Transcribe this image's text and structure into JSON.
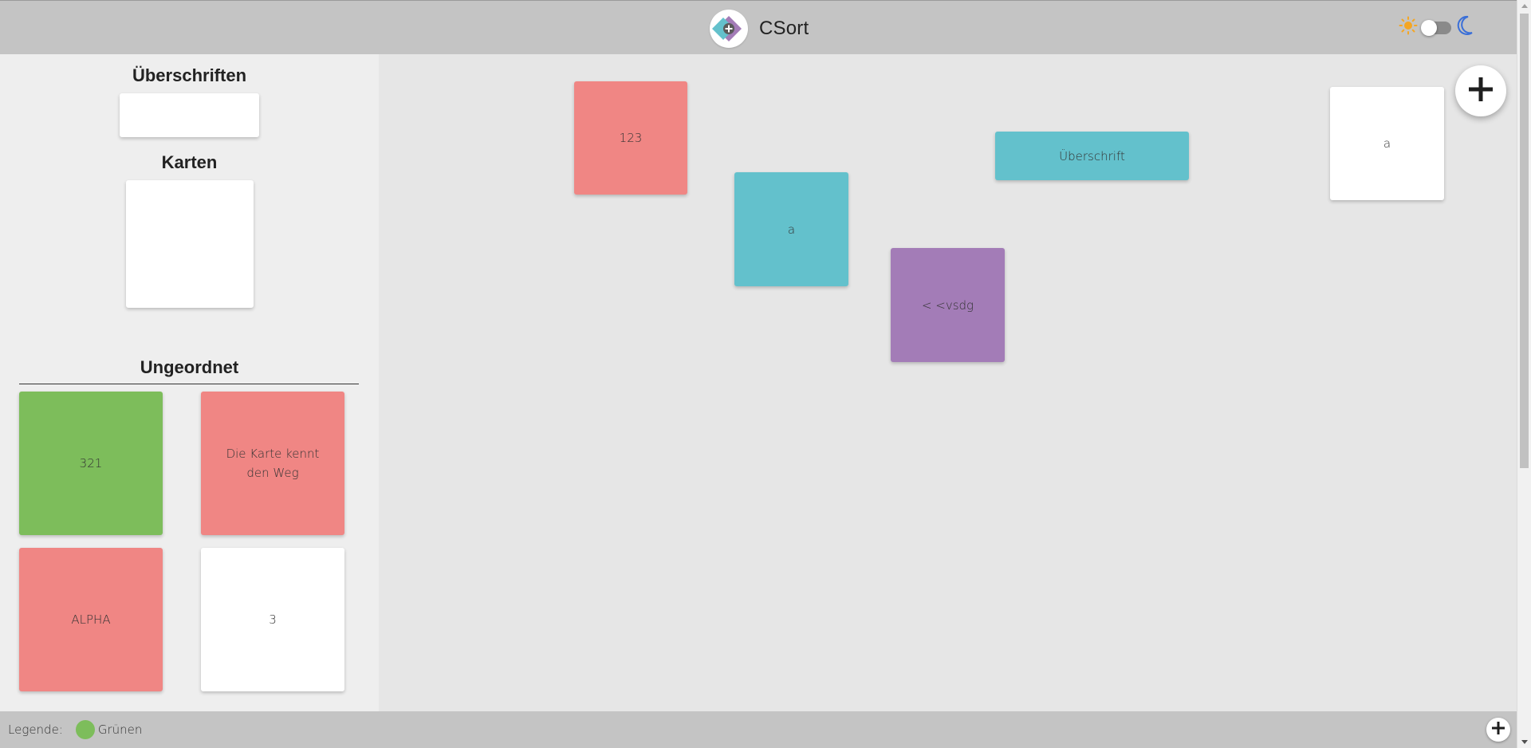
{
  "header": {
    "title": "CSort",
    "logo_icon": "csort-logo-icon",
    "theme": {
      "light_icon": "sun-icon",
      "dark_icon": "moon-icon",
      "toggle_state": "light"
    }
  },
  "sidebar": {
    "headings_title": "Überschriften",
    "cards_title": "Karten",
    "unordered_title": "Ungeordnet",
    "unordered_cards": [
      {
        "text": "321",
        "color": "#7dbd5b"
      },
      {
        "text": "Die Karte kennt den Weg",
        "color": "#f08684"
      },
      {
        "text": "ALPHA",
        "color": "#f08684"
      },
      {
        "text": "3",
        "color": "#ffffff"
      }
    ]
  },
  "board": {
    "cards": [
      {
        "text": "123",
        "color": "#f08684"
      },
      {
        "text": "a",
        "color": "#63c1cc"
      },
      {
        "text": "< <vsdg",
        "color": "#a37cb7"
      },
      {
        "text": "Überschrift",
        "color": "#63c1cc"
      },
      {
        "text": "a",
        "color": "#ffffff"
      }
    ],
    "add_icon": "plus-icon"
  },
  "footer": {
    "legend_label": "Legende:",
    "legend_items": [
      {
        "label": "Grünen",
        "color": "#7dbd5b"
      }
    ],
    "add_icon": "plus-icon"
  },
  "colors": {
    "header_bg": "#c4c4c4",
    "sidebar_bg": "#eeeeee",
    "board_bg": "#e6e6e6",
    "sun": "#f5a623",
    "moon": "#3a6fd8"
  }
}
